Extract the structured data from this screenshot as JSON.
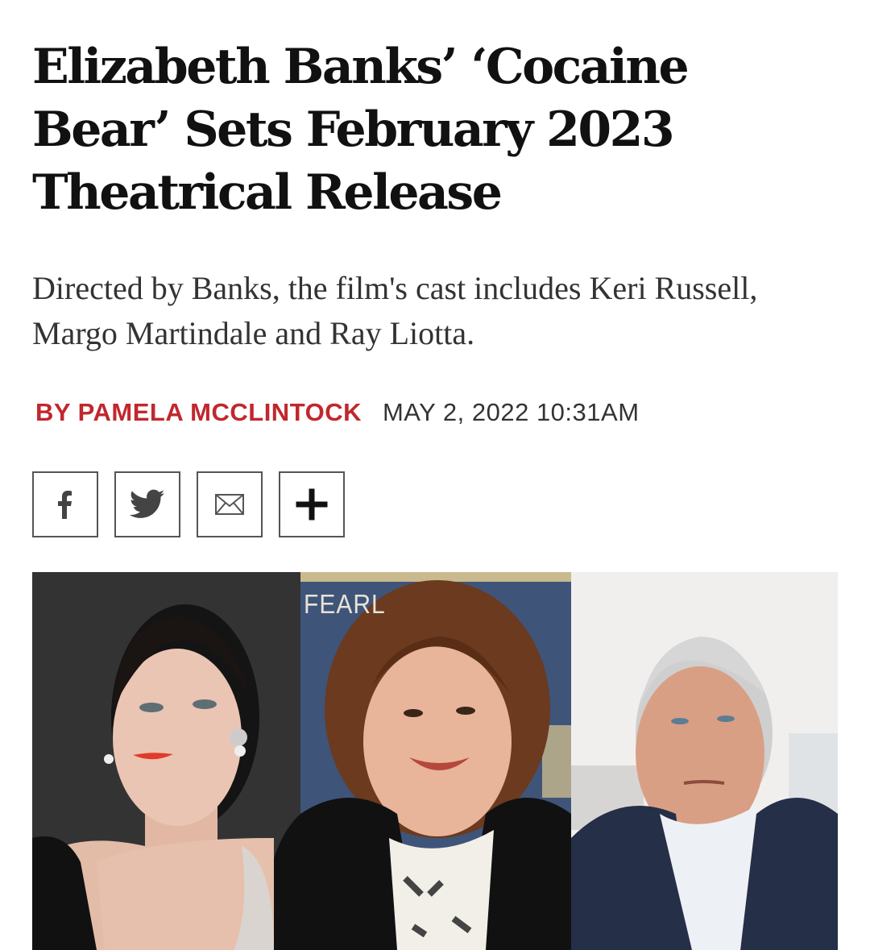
{
  "article": {
    "headline": "Elizabeth Banks’ ‘Cocaine Bear’ Sets February 2023 Theatrical Release",
    "dek": "Directed by Banks, the film's cast includes Keri Russell, Margo Martindale and Ray Liotta.",
    "byline": {
      "author": "BY PAMELA MCCLINTOCK",
      "date": "MAY 2, 2022 10:31AM"
    }
  },
  "share": [
    {
      "icon": "facebook-icon"
    },
    {
      "icon": "twitter-icon"
    },
    {
      "icon": "email-icon"
    },
    {
      "icon": "plus-icon"
    }
  ],
  "photo": {
    "backdrop_text": "FEARL"
  },
  "colors": {
    "accent": "#c1272d",
    "text": "#111111",
    "border": "#555555"
  }
}
